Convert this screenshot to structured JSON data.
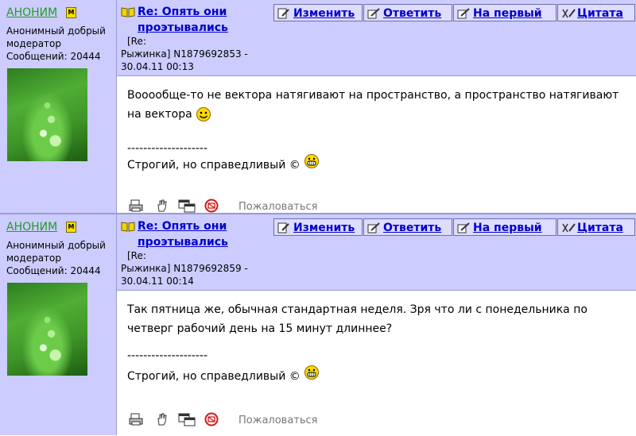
{
  "posts": [
    {
      "author": "АНОНИМ",
      "badge": "M",
      "rank": "Анонимный добрый модератор",
      "messages": "Сообщений: 20444",
      "title": "Re: Опять они проэтывались",
      "meta_line1": "[Re:",
      "meta_line2": "Рыжинка]  N1879692853 -",
      "meta_line3": "30.04.11 00:13",
      "text": "Вооообще-то не вектора натягивают на пространство, а пространство натягивают на вектора",
      "dashes": "--------------------",
      "signature": "Строгий, но справедливый ©",
      "complain": "Пожаловаться"
    },
    {
      "author": "АНОНИМ",
      "badge": "M",
      "rank": "Анонимный добрый модератор",
      "messages": "Сообщений: 20444",
      "title": "Re: Опять они проэтывались",
      "meta_line1": "[Re:",
      "meta_line2": "Рыжинка]  N1879692859 -",
      "meta_line3": "30.04.11 00:14",
      "text": "Так пятница же, обычная стандартная неделя. Зря что ли с понедельника по четверг рабочий день на 15 минут длиннее?",
      "dashes": "--------------------",
      "signature": "Строгий, но справедливый ©",
      "complain": "Пожаловаться"
    }
  ],
  "buttons": {
    "edit": "Изменить",
    "reply": "Ответить",
    "first": "На первый",
    "quote": "Цитата"
  },
  "icons": [
    "book-icon",
    "edit-icon",
    "reply-icon",
    "first-icon",
    "quote-icon",
    "smile-icon",
    "grin-icon",
    "print-icon",
    "hand-icon",
    "window-icon",
    "complain-icon"
  ],
  "colors": {
    "panel": "#ccccff",
    "link": "#0000cc",
    "author": "#1fa01f"
  }
}
